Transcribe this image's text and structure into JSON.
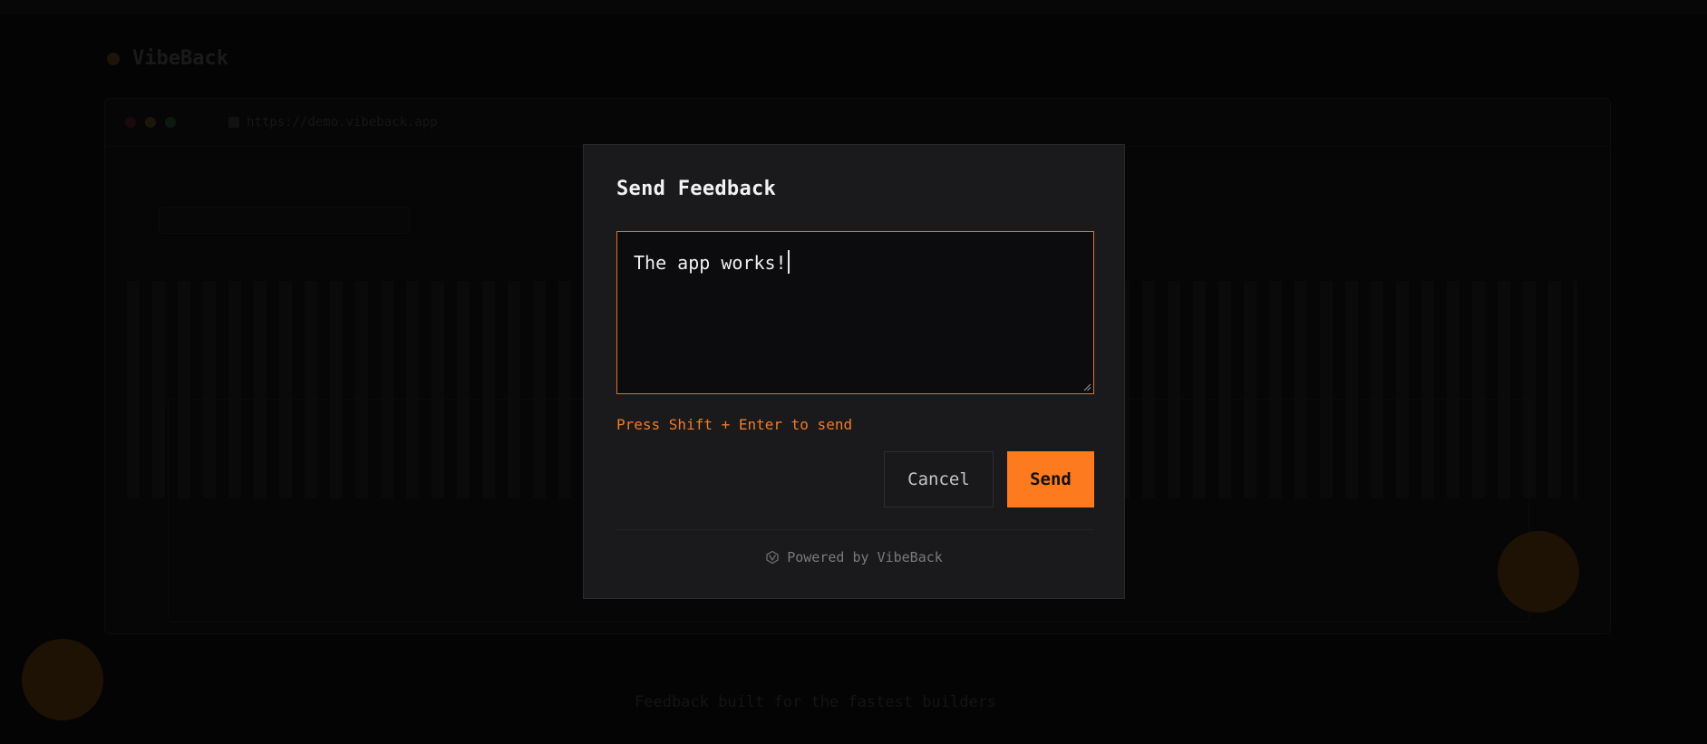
{
  "background": {
    "brand_label": "VibeBack",
    "url_label": "https://demo.vibeback.app",
    "footer_label": "Feedback built for the fastest builders",
    "accent_color": "#fd7a1f"
  },
  "modal": {
    "title": "Send Feedback",
    "feedback_input": {
      "value": "The app works!",
      "placeholder": ""
    },
    "hint": "Press Shift + Enter to send",
    "cancel_label": "Cancel",
    "send_label": "Send",
    "powered_by": "Powered by VibeBack",
    "colors": {
      "accent": "#fd7a1f",
      "hint": "#f07a26",
      "panel": "#1a1a1c",
      "input_bg": "#0c0c0f"
    }
  },
  "icons": {
    "powered_icon": "vibeback-logo-icon",
    "resize_icon": "resize-grip-icon"
  }
}
